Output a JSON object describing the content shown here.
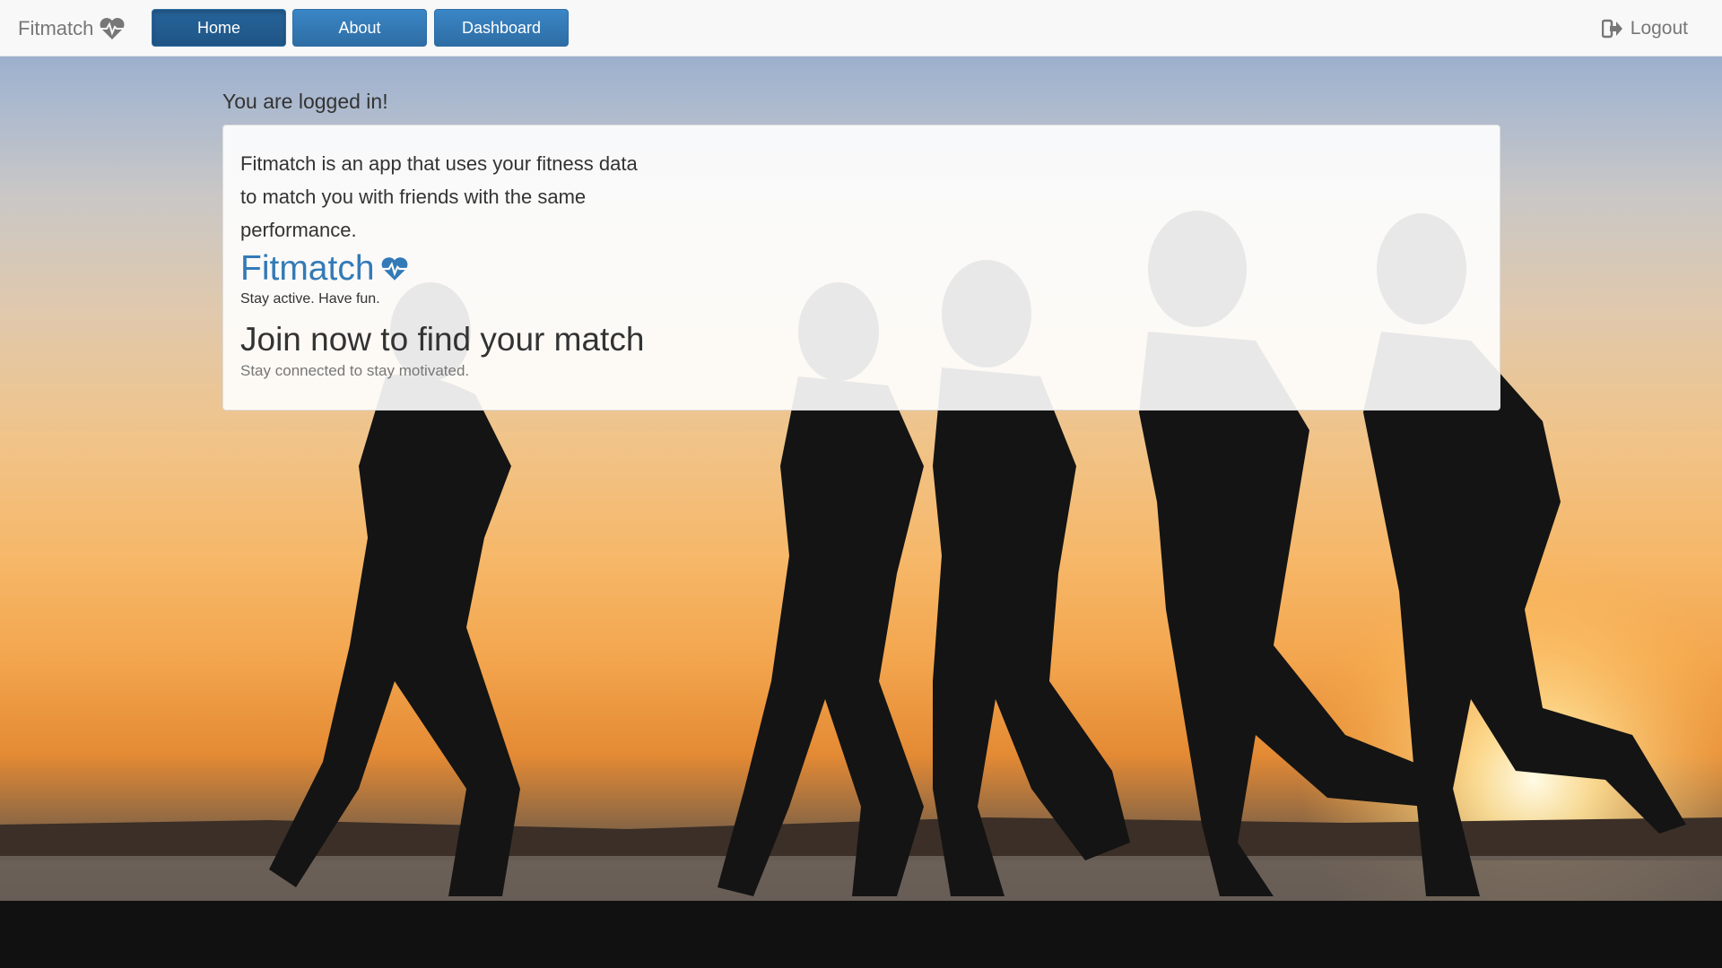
{
  "navbar": {
    "brand": "Fitmatch",
    "brand_icon": "heartbeat-icon",
    "buttons": [
      {
        "label": "Home",
        "active": true
      },
      {
        "label": "About",
        "active": false
      },
      {
        "label": "Dashboard",
        "active": false
      }
    ],
    "logout_label": "Logout",
    "logout_icon": "sign-out-icon"
  },
  "main": {
    "status": "You are logged in!",
    "intro": "Fitmatch is an app that uses your fitness data to match you with friends with the same performance.",
    "app_title": "Fitmatch",
    "tagline": "Stay active. Have fun.",
    "join_heading": "Join now to find your match",
    "join_subtext": "Stay connected to stay motivated."
  },
  "colors": {
    "primary": "#337ab7",
    "navbar_bg": "#f8f8f8",
    "button_active": "#26639a"
  }
}
